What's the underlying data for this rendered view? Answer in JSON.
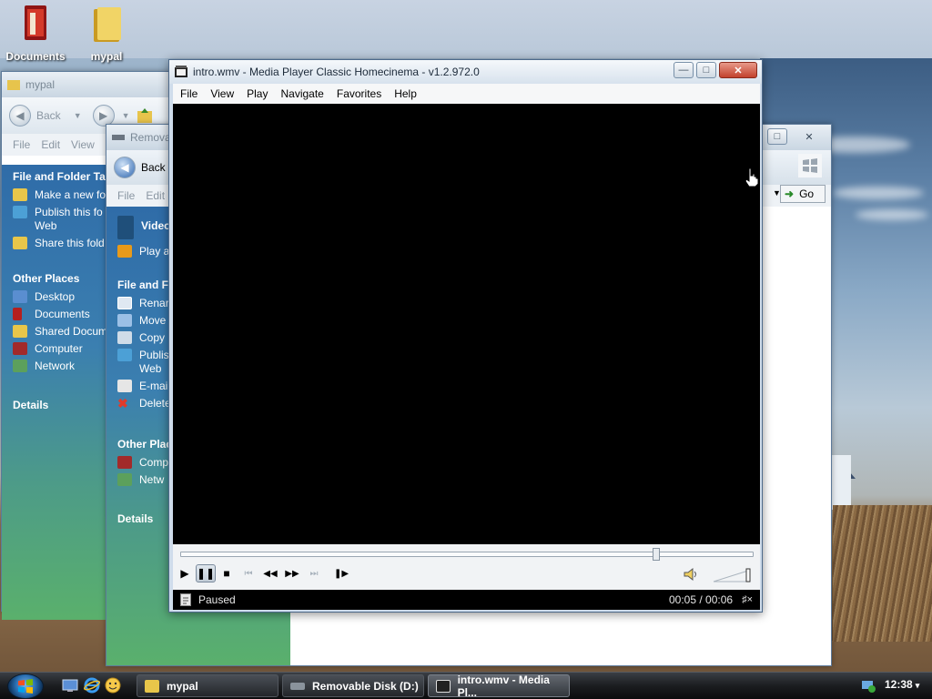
{
  "desktop": {
    "icons": [
      {
        "label": "Documents",
        "icon": "documents-folder-icon",
        "color": "#b51f1f"
      },
      {
        "label": "mypal",
        "icon": "folder-icon",
        "color": "#e8c64a"
      }
    ]
  },
  "explorer_mypal": {
    "title": "mypal",
    "back_label": "Back",
    "menu": [
      "File",
      "Edit",
      "View"
    ],
    "tasks_heading": "File and Folder Tas",
    "tasks": [
      {
        "label": "Make a new fo",
        "icon": "new-folder-icon"
      },
      {
        "label": "Publish this fo",
        "label2": "Web",
        "icon": "publish-icon"
      },
      {
        "label": "Share this fold",
        "icon": "share-icon"
      }
    ],
    "places_heading": "Other Places",
    "places": [
      {
        "label": "Desktop",
        "icon": "desktop-icon"
      },
      {
        "label": "Documents",
        "icon": "documents-icon"
      },
      {
        "label": "Shared Docum",
        "icon": "shared-folder-icon"
      },
      {
        "label": "Computer",
        "icon": "computer-icon"
      },
      {
        "label": "Network",
        "icon": "network-icon"
      }
    ],
    "details_heading": "Details"
  },
  "explorer_removable": {
    "title": "Removal",
    "back_label": "Back",
    "menu": [
      "File",
      "Edit"
    ],
    "video_heading": "Video Ta",
    "video_tasks": [
      {
        "label": "Play a",
        "icon": "play-icon"
      }
    ],
    "file_heading": "File and Fo",
    "file_tasks": [
      {
        "label": "Renar",
        "icon": "rename-icon"
      },
      {
        "label": "Move",
        "icon": "move-icon"
      },
      {
        "label": "Copy",
        "icon": "copy-icon"
      },
      {
        "label": "Publis",
        "label2": "Web",
        "icon": "publish-icon"
      },
      {
        "label": "E-mai",
        "icon": "email-icon"
      },
      {
        "label": "Delete",
        "icon": "delete-icon"
      }
    ],
    "places_heading": "Other Plac",
    "places": [
      {
        "label": "Comp",
        "icon": "computer-icon"
      },
      {
        "label": "Netw",
        "icon": "network-icon"
      }
    ],
    "details_heading": "Details",
    "go_label": "Go"
  },
  "mpc": {
    "title": "intro.wmv - Media Player Classic Homecinema - v1.2.972.0",
    "menu": [
      "File",
      "View",
      "Play",
      "Navigate",
      "Favorites",
      "Help"
    ],
    "status": "Paused",
    "time": "00:05 / 00:06",
    "progress_fraction": 0.83
  },
  "taskbar": {
    "buttons": [
      {
        "label": "mypal",
        "icon": "folder-icon"
      },
      {
        "label": "Removable Disk (D:)",
        "icon": "drive-icon"
      },
      {
        "label": "intro.wmv - Media Pl...",
        "icon": "media-player-icon"
      }
    ],
    "clock": "12:38"
  }
}
